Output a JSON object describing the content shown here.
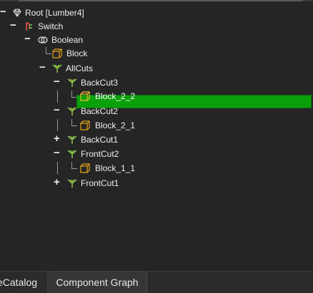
{
  "tree": {
    "root": {
      "label": "Root [Lumber4]",
      "toggle": "−"
    },
    "switch": {
      "label": "Switch",
      "toggle": "−"
    },
    "boolean": {
      "label": "Boolean",
      "toggle": "−"
    },
    "block": {
      "label": "Block"
    },
    "allcuts": {
      "label": "AllCuts",
      "toggle": "−"
    },
    "backcut3": {
      "label": "BackCut3",
      "toggle": "−"
    },
    "block22": {
      "label": "Block_2_2"
    },
    "backcut2": {
      "label": "BackCut2",
      "toggle": "−"
    },
    "block21": {
      "label": "Block_2_1"
    },
    "backcut1": {
      "label": "BackCut1",
      "toggle": "+"
    },
    "frontcut2": {
      "label": "FrontCut2",
      "toggle": "−"
    },
    "block11": {
      "label": "Block_1_1"
    },
    "frontcut1": {
      "label": "FrontCut1",
      "toggle": "+"
    }
  },
  "tabs": {
    "catalog": "eCatalog",
    "component_graph": "Component Graph"
  },
  "colors": {
    "background": "#252525",
    "selection": "#0aa00a",
    "cut_icon": "#9bd84a",
    "block_icon": "#e8a21a"
  },
  "selected_item": "Block_2_2"
}
